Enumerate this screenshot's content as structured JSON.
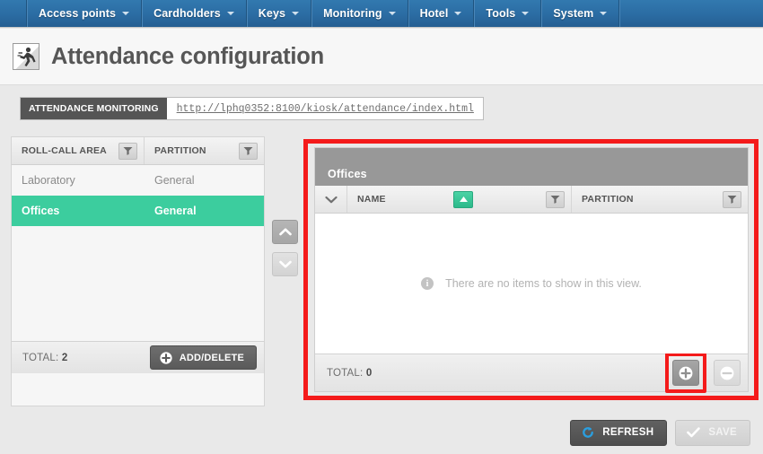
{
  "nav": {
    "items": [
      {
        "label": "Access points",
        "caret": true
      },
      {
        "label": "Cardholders",
        "caret": true
      },
      {
        "label": "Keys",
        "caret": true
      },
      {
        "label": "Monitoring",
        "caret": true
      },
      {
        "label": "Hotel",
        "caret": true
      },
      {
        "label": "Tools",
        "caret": true
      },
      {
        "label": "System",
        "caret": true
      }
    ]
  },
  "header": {
    "title": "Attendance configuration",
    "icon": "running-person-icon"
  },
  "url_bar": {
    "label": "ATTENDANCE MONITORING",
    "value": "http://lphq0352:8100/kiosk/attendance/index.html"
  },
  "left_panel": {
    "columns": [
      "ROLL-CALL AREA",
      "PARTITION"
    ],
    "rows": [
      {
        "area": "Laboratory",
        "partition": "General",
        "selected": false
      },
      {
        "area": "Offices",
        "partition": "General",
        "selected": true
      }
    ],
    "total_label": "TOTAL:",
    "total_value": "2",
    "add_delete_label": "ADD/DELETE"
  },
  "middle": {
    "up_label": "move-up",
    "down_label": "move-down"
  },
  "right_panel": {
    "title": "Offices",
    "columns": [
      "NAME",
      "PARTITION"
    ],
    "empty_message": "There are no items to show in this view.",
    "total_label": "TOTAL:",
    "total_value": "0",
    "add_label": "add",
    "remove_label": "remove"
  },
  "bottom_bar": {
    "refresh_label": "REFRESH",
    "save_label": "SAVE"
  },
  "colors": {
    "nav_blue": "#2b6ca3",
    "selection_green": "#3ccd9e",
    "sort_green": "#2cb98a",
    "highlight_red": "#f41a1a",
    "panel_header_gray": "#989898"
  }
}
